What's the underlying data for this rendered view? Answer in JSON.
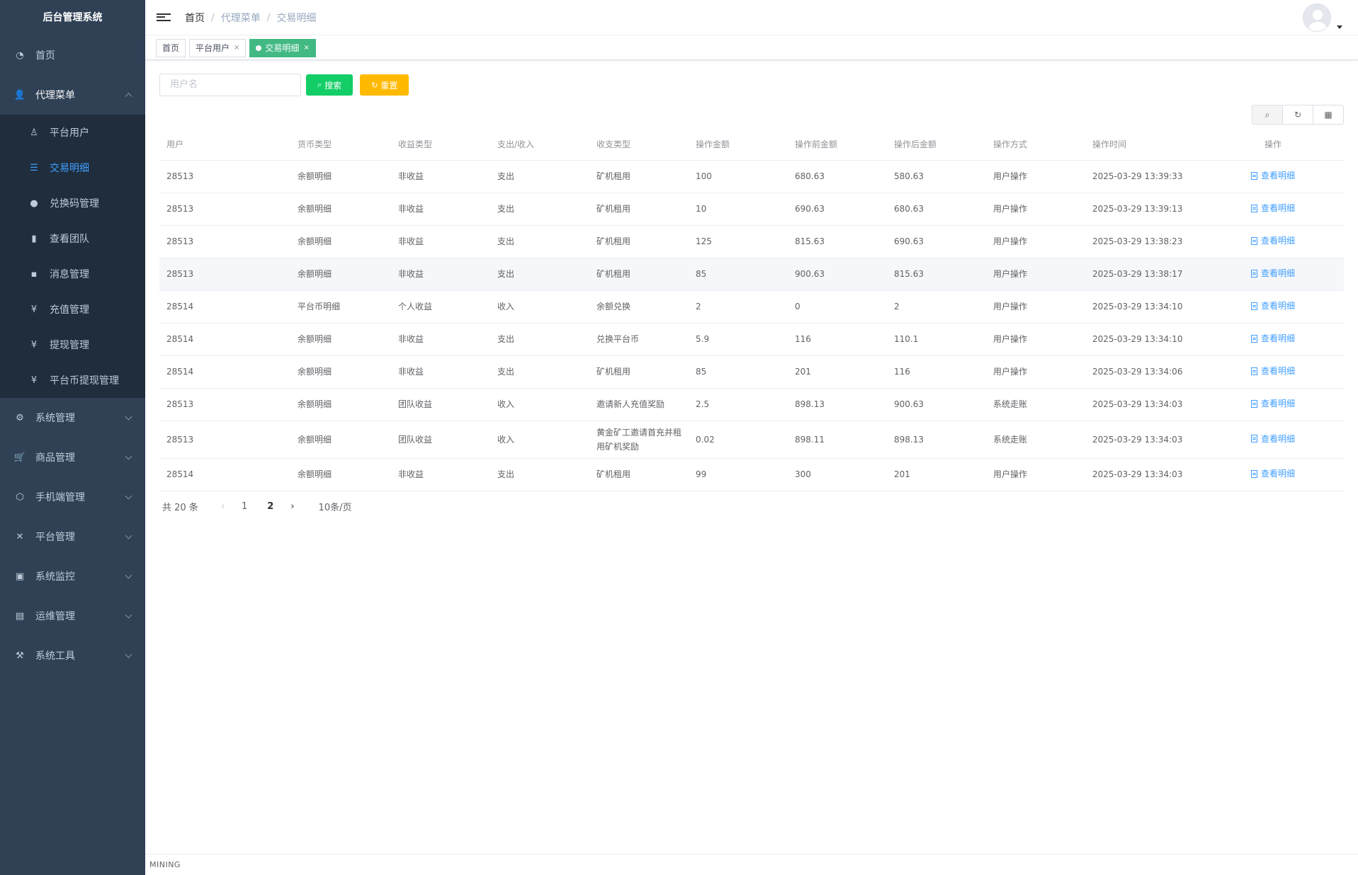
{
  "sidebar": {
    "logo": "后台管理系统",
    "items": [
      {
        "label": "首页",
        "icon": "dashboard-icon"
      },
      {
        "label": "代理菜单",
        "icon": "user-icon",
        "open": true
      },
      {
        "label": "系统管理",
        "icon": "gear-icon"
      },
      {
        "label": "商品管理",
        "icon": "cart-icon"
      },
      {
        "label": "手机端管理",
        "icon": "cube-icon"
      },
      {
        "label": "平台管理",
        "icon": "tools-icon"
      },
      {
        "label": "系统监控",
        "icon": "monitor-icon"
      },
      {
        "label": "运维管理",
        "icon": "server-icon"
      },
      {
        "label": "系统工具",
        "icon": "toolkit-icon"
      }
    ],
    "submenu": [
      {
        "label": "平台用户",
        "icon": "tree-icon"
      },
      {
        "label": "交易明细",
        "icon": "list-icon",
        "active": true
      },
      {
        "label": "兑换码管理",
        "icon": "bitcoin-icon"
      },
      {
        "label": "查看团队",
        "icon": "bar-chart-icon"
      },
      {
        "label": "消息管理",
        "icon": "message-icon"
      },
      {
        "label": "充值管理",
        "icon": "yen-icon"
      },
      {
        "label": "提现管理",
        "icon": "yen-icon"
      },
      {
        "label": "平台币提现管理",
        "icon": "yen-icon"
      }
    ]
  },
  "navbar": {
    "breadcrumb": [
      "首页",
      "代理菜单",
      "交易明细"
    ]
  },
  "tags": [
    {
      "label": "首页"
    },
    {
      "label": "平台用户",
      "close": "×"
    },
    {
      "label": "交易明细",
      "close": "×",
      "active": true
    }
  ],
  "search": {
    "username_placeholder": "用户名",
    "search_label": "搜索",
    "reset_label": "重置"
  },
  "table": {
    "columns": [
      "用户",
      "货币类型",
      "收益类型",
      "支出/收入",
      "收支类型",
      "操作金额",
      "操作前金额",
      "操作后金额",
      "操作方式",
      "操作时间",
      "操作"
    ],
    "action_label": "查看明细",
    "rows": [
      [
        "28513",
        "余额明细",
        "非收益",
        "支出",
        "矿机租用",
        "100",
        "680.63",
        "580.63",
        "用户操作",
        "2025-03-29 13:39:33"
      ],
      [
        "28513",
        "余额明细",
        "非收益",
        "支出",
        "矿机租用",
        "10",
        "690.63",
        "680.63",
        "用户操作",
        "2025-03-29 13:39:13"
      ],
      [
        "28513",
        "余额明细",
        "非收益",
        "支出",
        "矿机租用",
        "125",
        "815.63",
        "690.63",
        "用户操作",
        "2025-03-29 13:38:23"
      ],
      [
        "28513",
        "余额明细",
        "非收益",
        "支出",
        "矿机租用",
        "85",
        "900.63",
        "815.63",
        "用户操作",
        "2025-03-29 13:38:17"
      ],
      [
        "28514",
        "平台币明细",
        "个人收益",
        "收入",
        "余额兑换",
        "2",
        "0",
        "2",
        "用户操作",
        "2025-03-29 13:34:10"
      ],
      [
        "28514",
        "余额明细",
        "非收益",
        "支出",
        "兑换平台币",
        "5.9",
        "116",
        "110.1",
        "用户操作",
        "2025-03-29 13:34:10"
      ],
      [
        "28514",
        "余额明细",
        "非收益",
        "支出",
        "矿机租用",
        "85",
        "201",
        "116",
        "用户操作",
        "2025-03-29 13:34:06"
      ],
      [
        "28513",
        "余额明细",
        "团队收益",
        "收入",
        "邀请新人充值奖励",
        "2.5",
        "898.13",
        "900.63",
        "系统走账",
        "2025-03-29 13:34:03"
      ],
      [
        "28513",
        "余额明细",
        "团队收益",
        "收入",
        "黄金矿工邀请首充并租用矿机奖励",
        "0.02",
        "898.11",
        "898.13",
        "系统走账",
        "2025-03-29 13:34:03"
      ],
      [
        "28514",
        "余额明细",
        "非收益",
        "支出",
        "矿机租用",
        "99",
        "300",
        "201",
        "用户操作",
        "2025-03-29 13:34:03"
      ]
    ]
  },
  "pagination": {
    "total": "共 20 条",
    "pages": [
      "1",
      "2"
    ],
    "current": "2",
    "page_size": "10条/页"
  },
  "footer": "MINING"
}
